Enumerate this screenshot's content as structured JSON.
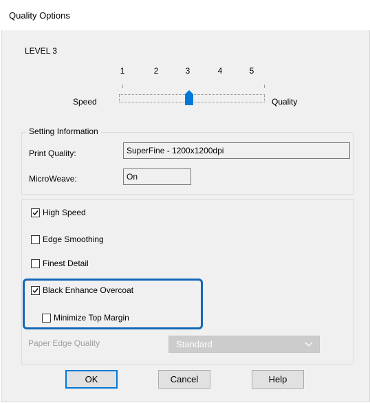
{
  "window": {
    "title": "Quality Options"
  },
  "level": {
    "label": "LEVEL 3"
  },
  "slider": {
    "ticks": [
      "1",
      "2",
      "3",
      "4",
      "5"
    ],
    "left_label": "Speed",
    "right_label": "Quality",
    "value": 3,
    "thumb_color": "#0078d7"
  },
  "setting_info": {
    "legend": "Setting Information",
    "print_quality_label": "Print Quality:",
    "print_quality_value": "SuperFine - 1200x1200dpi",
    "microweave_label": "MicroWeave:",
    "microweave_value": "On"
  },
  "options": {
    "high_speed": {
      "label": "High Speed",
      "checked": true
    },
    "edge_smoothing": {
      "label": "Edge Smoothing",
      "checked": false
    },
    "finest_detail": {
      "label": "Finest Detail",
      "checked": false
    },
    "black_enhance": {
      "label": "Black Enhance Overcoat",
      "checked": true
    },
    "minimize_top_margin": {
      "label": "Minimize Top Margin",
      "checked": false
    }
  },
  "paper_edge": {
    "label": "Paper Edge Quality",
    "value": "Standard"
  },
  "buttons": {
    "ok": "OK",
    "cancel": "Cancel",
    "help": "Help"
  },
  "colors": {
    "highlight": "#1467b8",
    "accent": "#0078d7"
  }
}
